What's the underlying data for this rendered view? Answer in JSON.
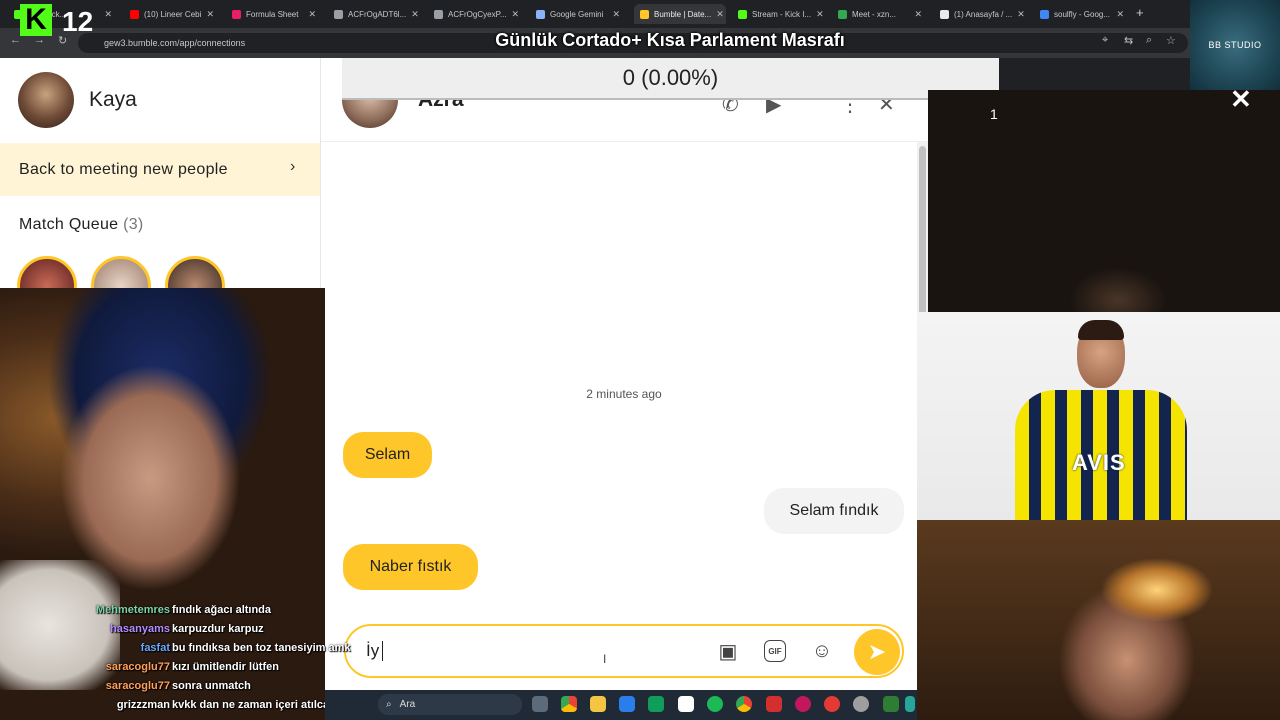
{
  "browser": {
    "tabs": [
      {
        "label": "(10) Kick...",
        "color": "#53fc18"
      },
      {
        "label": "(10) Lineer Cebi",
        "color": "#ff0000"
      },
      {
        "label": "Formula Sheet",
        "color": "#e91e63"
      },
      {
        "label": "ACFrOgADT6l...",
        "color": "#9aa0a6"
      },
      {
        "label": "ACFrOgCyexP...",
        "color": "#9aa0a6"
      },
      {
        "label": "Google Gemini",
        "color": "#8ab4f8"
      },
      {
        "label": "Bumble | Date...",
        "color": "#ffc629"
      },
      {
        "label": "Stream - Kick I...",
        "color": "#53fc18"
      },
      {
        "label": "Meet - xzn...",
        "color": "#34a853"
      },
      {
        "label": "(1) Anasayfa / ...",
        "color": "#e8eaed"
      },
      {
        "label": "soulfly - Goog...",
        "color": "#4285f4"
      }
    ],
    "new_tab": "+",
    "url": "gew3.bumble.com/app/connections"
  },
  "overlay": {
    "logo_letter": "K",
    "logo_number": "12",
    "title": "Günlük Cortado+ Kısa Parlament Masrafı",
    "counter": "0 (0.00%)",
    "studio": "BB STUDIO",
    "topright_number": "1",
    "close": "✕"
  },
  "sidebar": {
    "user_name": "Kaya",
    "back_link": "Back to meeting new people",
    "match_queue_label": "Match Queue",
    "match_queue_count": "(3)"
  },
  "chat": {
    "contact_name": "Azra",
    "timestamp": "2 minutes ago",
    "messages": [
      {
        "direction": "in",
        "text": "Selam"
      },
      {
        "direction": "out",
        "text": "Selam fındık"
      },
      {
        "direction": "in",
        "text": "Naber fıstık"
      }
    ],
    "composer_value": "İy"
  },
  "jersey": {
    "text": "AVIS"
  },
  "stream_chat": [
    {
      "user": "Mehmetemres",
      "color": "#7dd3a8",
      "text": "fındık ağacı altında"
    },
    {
      "user": "hasanyams",
      "color": "#b48cff",
      "text": "karpuzdur karpuz"
    },
    {
      "user": "fasfat",
      "color": "#6aa8ff",
      "text": "bu fındıksa ben toz tanesiyim amk"
    },
    {
      "user": "saracoglu77",
      "color": "#ff9f5a",
      "text": "kızı ümitlendir lütfen"
    },
    {
      "user": "saracoglu77",
      "color": "#ff9f5a",
      "text": "sonra unmatch"
    },
    {
      "user": "grizzzman",
      "color": "#ffffff",
      "text": "kvkk dan ne zaman içeri atılcak acaba"
    }
  ],
  "taskbar": {
    "search_placeholder": "Ara"
  }
}
